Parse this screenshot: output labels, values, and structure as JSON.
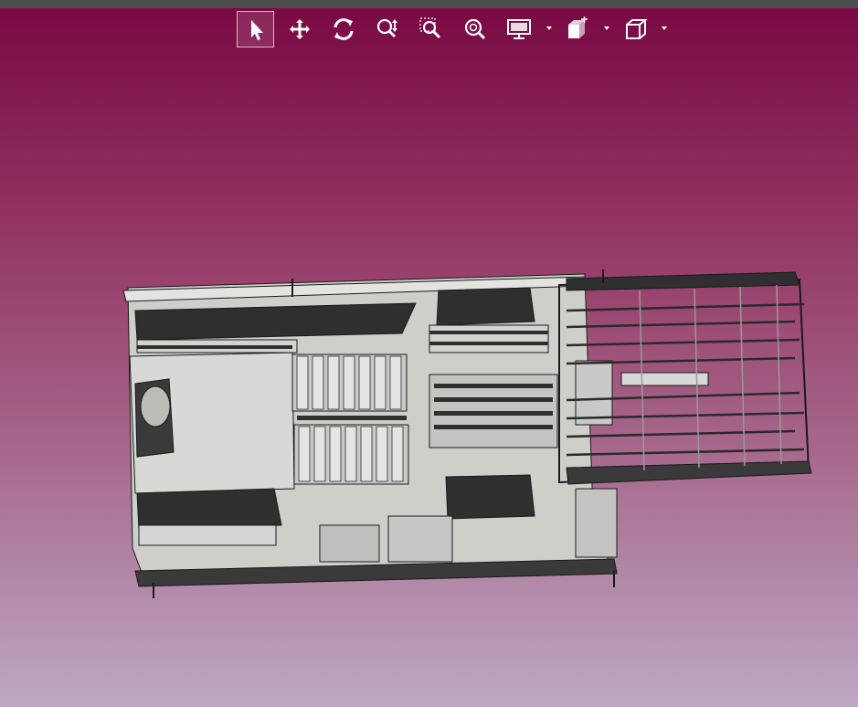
{
  "window": {
    "background_top": "#7a0a45",
    "background_bottom": "#bda8c2",
    "top_strip": "#4d4d4d"
  },
  "toolbar": {
    "items": [
      {
        "id": "select",
        "icon": "arrow-cursor-icon",
        "active": true
      },
      {
        "id": "pan",
        "icon": "move-arrows-icon",
        "active": false
      },
      {
        "id": "rotate",
        "icon": "rotate-icon",
        "active": false
      },
      {
        "id": "zoom",
        "icon": "zoom-updown-icon",
        "active": false
      },
      {
        "id": "zoom-window",
        "icon": "zoom-window-icon",
        "active": false
      },
      {
        "id": "zoom-fit",
        "icon": "zoom-fit-icon",
        "active": false
      },
      {
        "id": "display-mode",
        "icon": "monitor-icon",
        "dropdown": true
      },
      {
        "id": "view-layers",
        "icon": "layers-icon",
        "dropdown": true
      },
      {
        "id": "standard-views",
        "icon": "cube-icon",
        "dropdown": true
      }
    ]
  },
  "viewport": {
    "model": "cad-machine-assembly",
    "colors": {
      "part_light": "#d8d8d4",
      "part_dark": "#2f2f2f",
      "edge": "#1a1a1a"
    }
  }
}
